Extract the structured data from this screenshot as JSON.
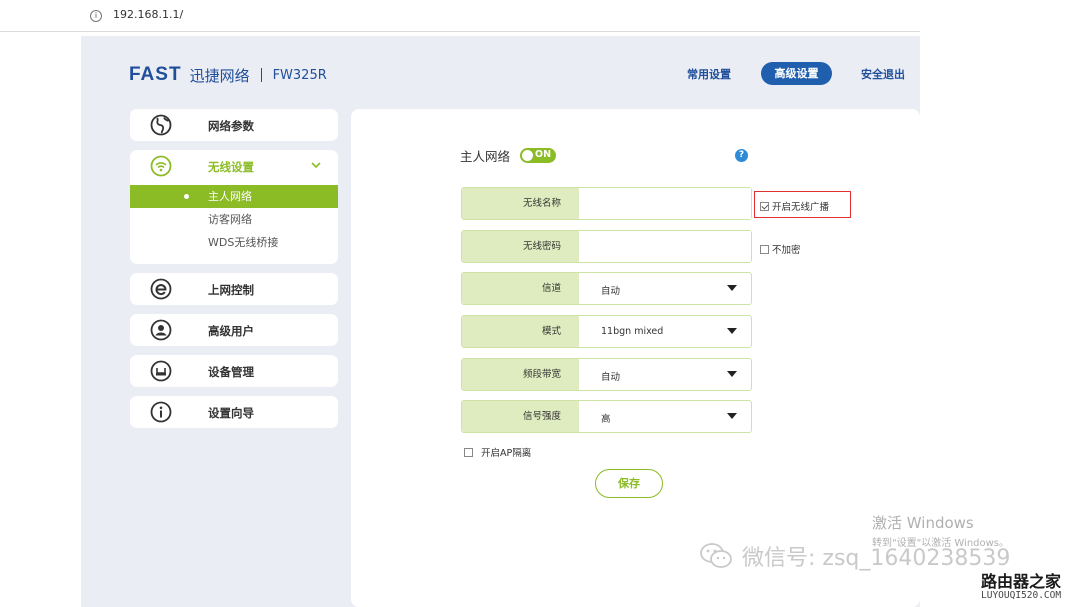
{
  "browser": {
    "url": "192.168.1.1/"
  },
  "brand": {
    "logo": "FAST",
    "name": "迅捷网络",
    "model": "FW325R"
  },
  "topnav": {
    "common": "常用设置",
    "advanced": "高级设置",
    "logout": "安全退出"
  },
  "sidebar": {
    "items": [
      {
        "label": "网络参数",
        "icon": "globe-icon"
      },
      {
        "label": "无线设置",
        "icon": "wifi-icon"
      },
      {
        "label": "上网控制",
        "icon": "ie-icon"
      },
      {
        "label": "高级用户",
        "icon": "user-icon"
      },
      {
        "label": "设备管理",
        "icon": "device-icon"
      },
      {
        "label": "设置向导",
        "icon": "info-icon"
      }
    ],
    "wireless_sub": [
      "主人网络",
      "访客网络",
      "WDS无线桥接"
    ]
  },
  "main": {
    "title": "主人网络",
    "toggle": "ON",
    "help": "?",
    "fields": {
      "ssid_label": "无线名称",
      "ssid_value": "",
      "password_label": "无线密码",
      "password_value": "",
      "channel_label": "信道",
      "channel_value": "自动",
      "mode_label": "模式",
      "mode_value": "11bgn mixed",
      "bandwidth_label": "频段带宽",
      "bandwidth_value": "自动",
      "signal_label": "信号强度",
      "signal_value": "高"
    },
    "broadcast_label": "开启无线广播",
    "broadcast_checked": true,
    "no_encrypt_label": "不加密",
    "no_encrypt_checked": false,
    "ap_isolation_label": "开启AP隔离",
    "ap_isolation_checked": false,
    "save_label": "保存"
  },
  "watermarks": {
    "activate_title": "激活 Windows",
    "activate_sub": "转到\"设置\"以激活 Windows。",
    "wechat": "微信号: zsq_1640238539",
    "site_name": "路由器之家",
    "site_url": "LUYOUQI520.COM"
  },
  "colors": {
    "brand_blue": "#1f4e9a",
    "accent_green": "#8bbc25",
    "active_nav": "#1f5fad",
    "alert_red": "#e03030"
  }
}
